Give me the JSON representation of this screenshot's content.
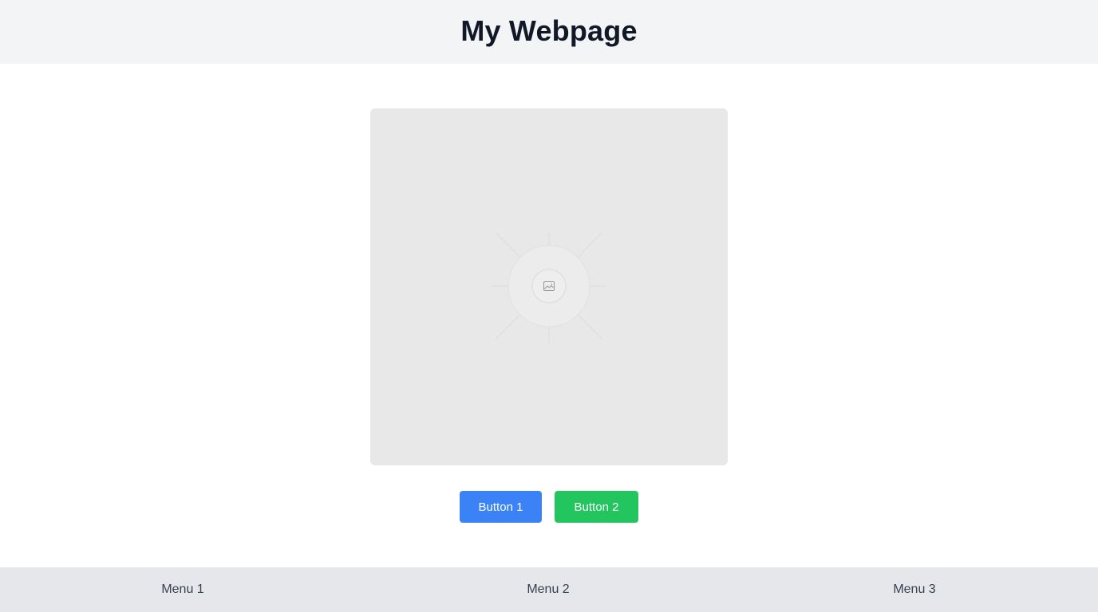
{
  "header": {
    "title": "My Webpage"
  },
  "main": {
    "image": {
      "icon": "image-icon",
      "background_color": "#e8e8e8"
    },
    "buttons": [
      {
        "label": "Button 1",
        "color": "#3b82f6"
      },
      {
        "label": "Button 2",
        "color": "#22c55e"
      }
    ]
  },
  "footer_nav": {
    "items": [
      {
        "label": "Menu 1"
      },
      {
        "label": "Menu 2"
      },
      {
        "label": "Menu 3"
      }
    ]
  },
  "colors": {
    "header_bg": "#f3f4f6",
    "footer_bg": "#e5e7eb",
    "title_text": "#111827",
    "menu_text": "#374151"
  }
}
